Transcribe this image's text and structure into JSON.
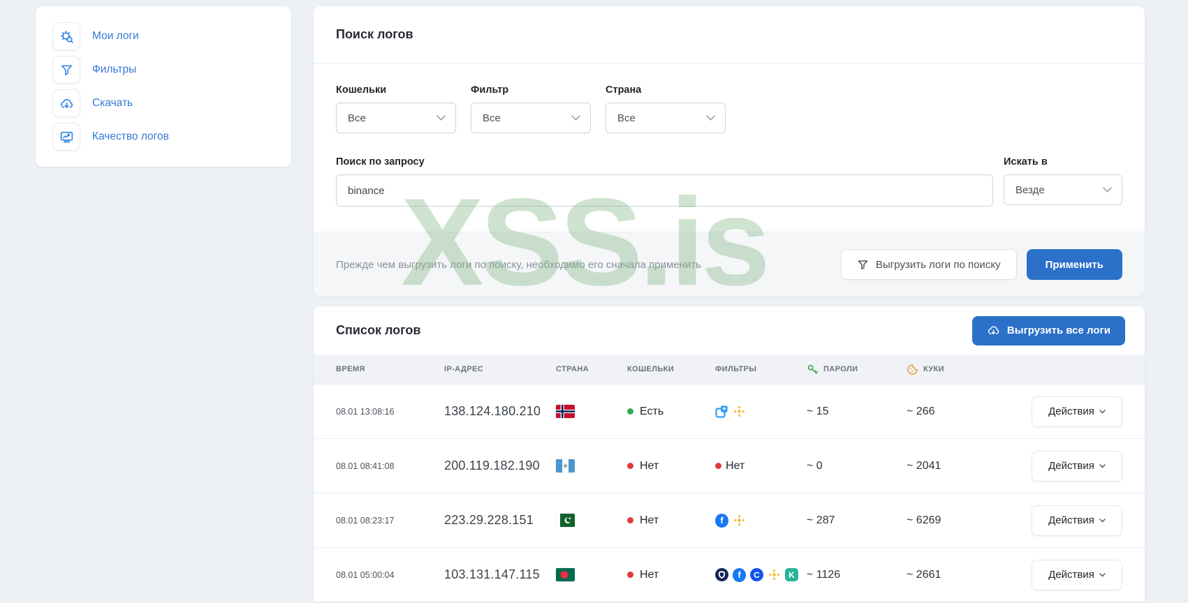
{
  "sidebar": {
    "items": [
      {
        "label": "Мои логи",
        "icon": "logs-search-icon"
      },
      {
        "label": "Фильтры",
        "icon": "funnel-icon"
      },
      {
        "label": "Скачать",
        "icon": "cloud-download-icon"
      },
      {
        "label": "Качество логов",
        "icon": "monitor-chart-icon"
      }
    ]
  },
  "search_panel": {
    "title": "Поиск логов",
    "filters": [
      {
        "label": "Кошельки",
        "value": "Все"
      },
      {
        "label": "Фильтр",
        "value": "Все"
      },
      {
        "label": "Страна",
        "value": "Все"
      }
    ],
    "query": {
      "label": "Поиск по запросу",
      "value": "binance"
    },
    "search_in": {
      "label": "Искать в",
      "value": "Везде"
    },
    "notice": "Прежде чем выгрузить логи по поиску, необходимо его сначала применить",
    "export_by_search_button": "Выгрузить логи по поиску",
    "apply_button": "Применить"
  },
  "logs_panel": {
    "title": "Список логов",
    "export_all_button": "Выгрузить все логи",
    "columns": [
      "ВРЕМЯ",
      "IP-АДРЕС",
      "СТРАНА",
      "КОШЕЛЬКИ",
      "ФИЛЬТРЫ",
      "ПАРОЛИ",
      "КУКИ"
    ],
    "actions_label": "Действия",
    "rows": [
      {
        "time": "08.01 13:08:16",
        "ip": "138.124.180.210",
        "country": "norway",
        "wallets": {
          "label": "Есть",
          "status": "yes"
        },
        "filters": [
          "exchange",
          "binance"
        ],
        "passwords": "~ 15",
        "cookies": "~ 266"
      },
      {
        "time": "08.01 08:41:08",
        "ip": "200.119.182.190",
        "country": "guatemala",
        "wallets": {
          "label": "Нет",
          "status": "no"
        },
        "filters": [],
        "filters_label": "Нет",
        "passwords": "~ 0",
        "cookies": "~ 2041"
      },
      {
        "time": "08.01 08:23:17",
        "ip": "223.29.228.151",
        "country": "pakistan",
        "wallets": {
          "label": "Нет",
          "status": "no"
        },
        "filters": [
          "facebook",
          "binance"
        ],
        "passwords": "~ 287",
        "cookies": "~ 6269"
      },
      {
        "time": "08.01 05:00:04",
        "ip": "103.131.147.115",
        "country": "bangladesh",
        "wallets": {
          "label": "Нет",
          "status": "no"
        },
        "filters": [
          "crypto-com",
          "facebook",
          "coinbase",
          "binance",
          "kucoin"
        ],
        "passwords": "~ 1126",
        "cookies": "~ 2661"
      }
    ]
  },
  "watermark": "XSS.is",
  "colors": {
    "accent_blue": "#2b70c9",
    "link_blue": "#3878d8",
    "status_green": "#2fae52",
    "status_red": "#df3a3a",
    "watermark_green": "#a9d2ad",
    "binance_yellow": "#f3ba2f"
  }
}
